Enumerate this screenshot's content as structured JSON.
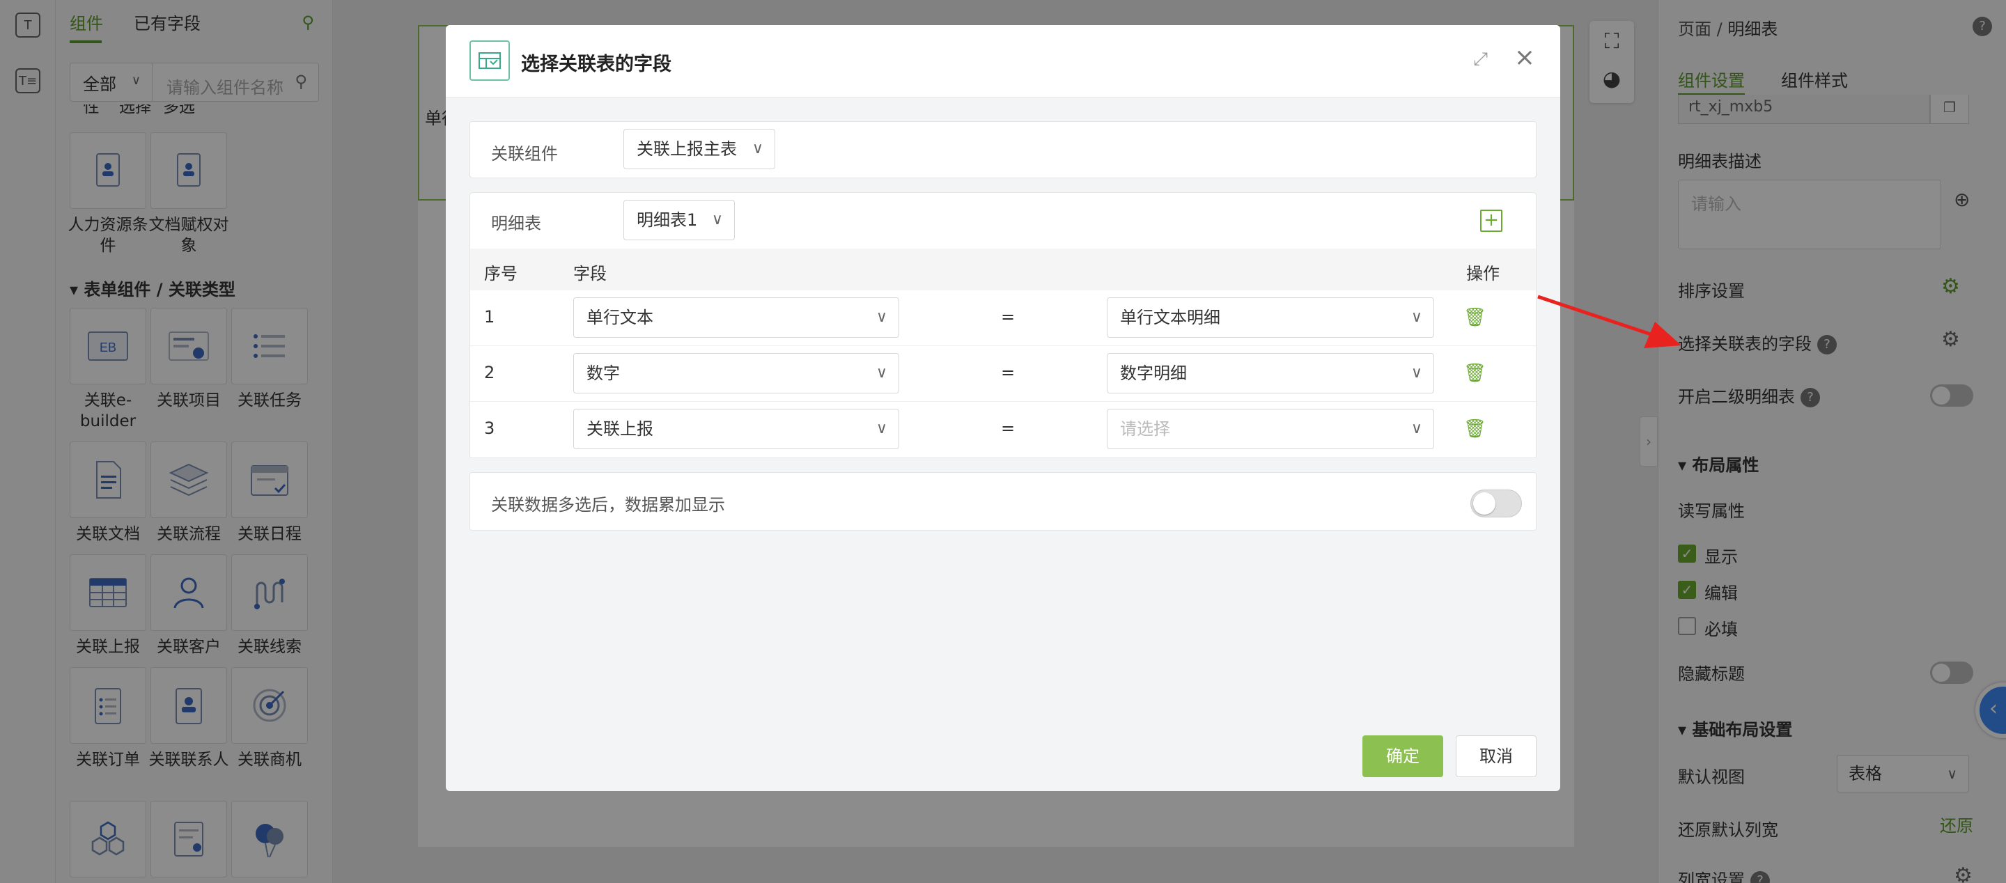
{
  "left_panel": {
    "tabs": [
      "组件",
      "已有字段"
    ],
    "filter_select": "全部",
    "search_placeholder": "请输入组件名称",
    "top_partial_labels": [
      "性",
      "选择",
      "多选"
    ],
    "row1": [
      {
        "label": "人力资源条件",
        "icon": "id-card-icon"
      },
      {
        "label": "文档赋权对象",
        "icon": "id-badge-icon"
      }
    ],
    "section_title": "表单组件 / 关联类型",
    "items": [
      {
        "label": "关联e-builder",
        "icon": "eb-icon"
      },
      {
        "label": "关联项目",
        "icon": "project-icon"
      },
      {
        "label": "关联任务",
        "icon": "task-list-icon"
      },
      {
        "label": "关联文档",
        "icon": "document-icon"
      },
      {
        "label": "关联流程",
        "icon": "layers-icon"
      },
      {
        "label": "关联日程",
        "icon": "calendar-icon"
      },
      {
        "label": "关联上报",
        "icon": "table-icon"
      },
      {
        "label": "关联客户",
        "icon": "user-icon"
      },
      {
        "label": "关联线索",
        "icon": "clue-icon"
      },
      {
        "label": "关联订单",
        "icon": "order-icon"
      },
      {
        "label": "关联联系人",
        "icon": "contact-icon"
      },
      {
        "label": "关联商机",
        "icon": "target-icon"
      }
    ]
  },
  "canvas": {
    "partial_text": "单行"
  },
  "right_panel": {
    "breadcrumb_page": "页面",
    "breadcrumb_current": "明细表",
    "tabs": [
      "组件设置",
      "组件样式"
    ],
    "top_input_value": "rt_xj_mxb5",
    "desc_label": "明细表描述",
    "desc_placeholder": "请输入",
    "sort_label": "排序设置",
    "select_fields_label": "选择关联表的字段",
    "second_level_label": "开启二级明细表",
    "layout_section": "布局属性",
    "rw_label": "读写属性",
    "checks": [
      {
        "label": "显示",
        "checked": true
      },
      {
        "label": "编辑",
        "checked": true
      },
      {
        "label": "必填",
        "checked": false
      }
    ],
    "hide_title_label": "隐藏标题",
    "basic_layout_section": "基础布局设置",
    "default_view_label": "默认视图",
    "default_view_value": "表格",
    "restore_width_label": "还原默认列宽",
    "restore_link": "还原",
    "col_width_label": "列宽设置"
  },
  "modal": {
    "title": "选择关联表的字段",
    "assoc_label": "关联组件",
    "assoc_value": "关联上报主表",
    "detail_label": "明细表",
    "detail_value": "明细表1",
    "headers": {
      "index": "序号",
      "field": "字段",
      "action": "操作"
    },
    "rows": [
      {
        "index": "1",
        "left": "单行文本",
        "eq": "=",
        "right": "单行文本明细",
        "right_placeholder": false
      },
      {
        "index": "2",
        "left": "数字",
        "eq": "=",
        "right": "数字明细",
        "right_placeholder": false
      },
      {
        "index": "3",
        "left": "关联上报",
        "eq": "=",
        "right": "请选择",
        "right_placeholder": true
      }
    ],
    "multi_label": "关联数据多选后，数据累加显示",
    "ok": "确定",
    "cancel": "取消"
  },
  "colors": {
    "accent_green": "#8cc152",
    "arrow_red": "#e8231f"
  }
}
